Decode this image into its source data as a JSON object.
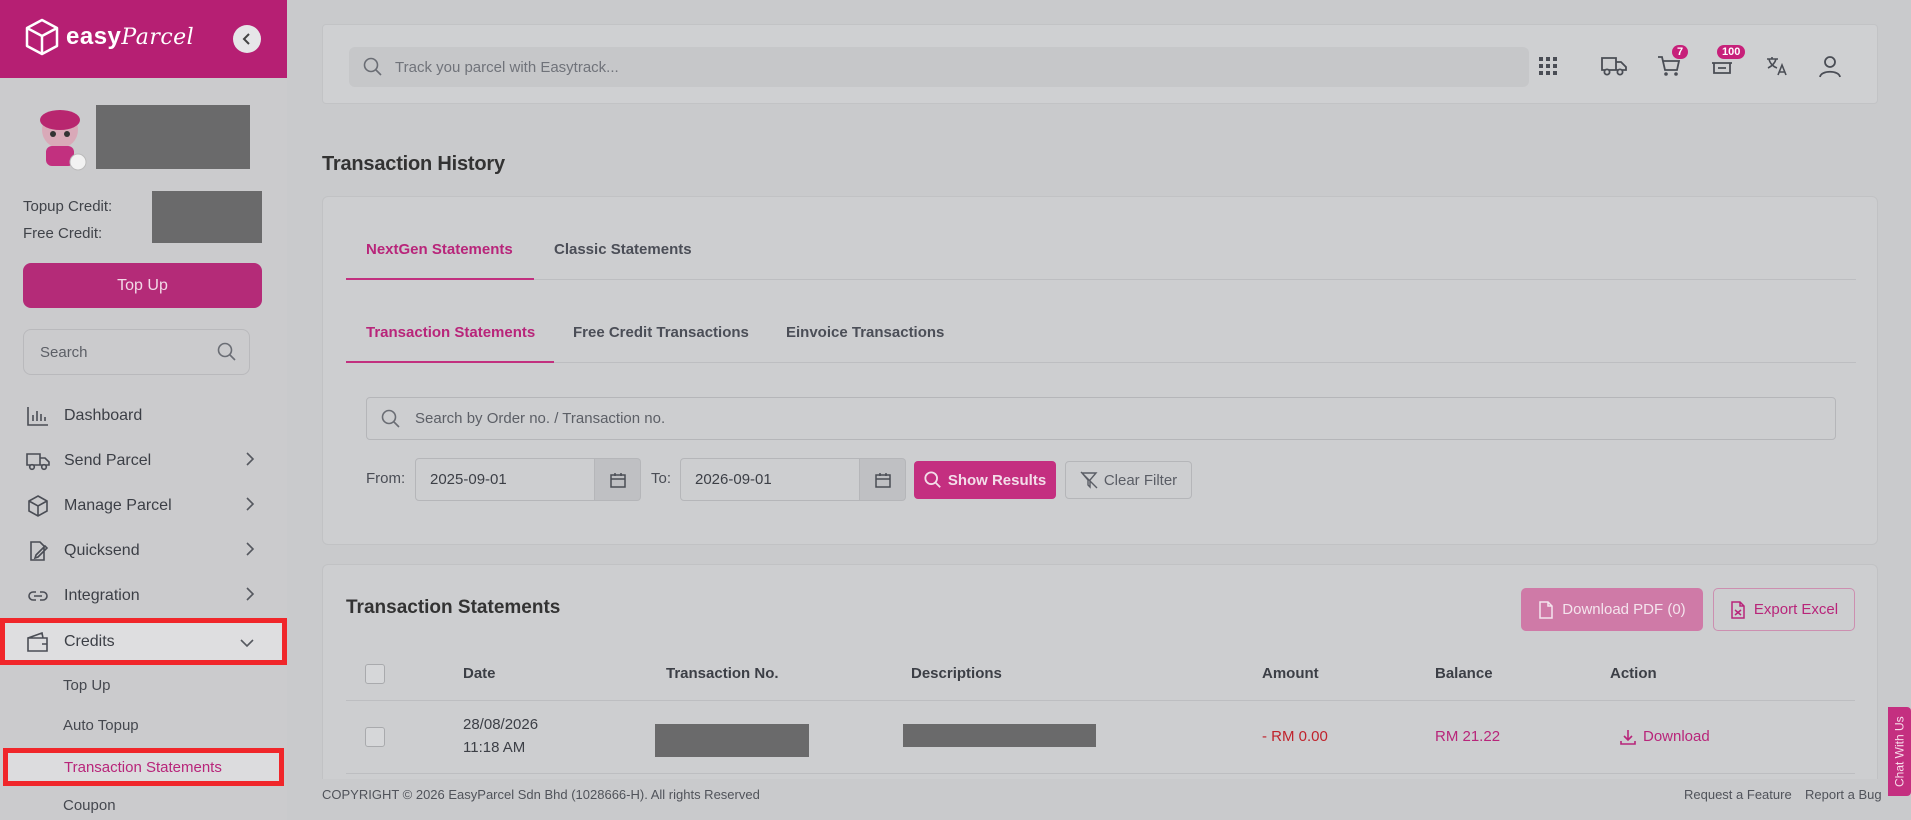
{
  "brand": {
    "logo_text": "easy",
    "logo_script": "Parcel"
  },
  "sidebar": {
    "topup_credit_label": "Topup Credit:",
    "free_credit_label": "Free Credit:",
    "topup_button": "Top Up",
    "search_placeholder": "Search",
    "items": [
      {
        "label": "Dashboard"
      },
      {
        "label": "Send Parcel"
      },
      {
        "label": "Manage Parcel"
      },
      {
        "label": "Quicksend"
      },
      {
        "label": "Integration"
      },
      {
        "label": "Credits"
      }
    ],
    "credits_sub": [
      "Top Up",
      "Auto Topup",
      "Transaction Statements",
      "Coupon"
    ]
  },
  "topbar": {
    "track_placeholder": "Track you parcel with Easytrack...",
    "cart_badge": "7",
    "notif_badge": "100"
  },
  "page": {
    "title": "Transaction History"
  },
  "tabs": {
    "primary": [
      "NextGen Statements",
      "Classic Statements"
    ],
    "secondary": [
      "Transaction Statements",
      "Free Credit Transactions",
      "Einvoice Transactions"
    ]
  },
  "filter": {
    "search_placeholder": "Search by Order no. / Transaction no.",
    "from_label": "From:",
    "from_value": "2025-09-01",
    "to_label": "To:",
    "to_value": "2026-09-01",
    "show_results": "Show Results",
    "clear_filter": "Clear Filter"
  },
  "statements": {
    "title": "Transaction Statements",
    "download_pdf": "Download PDF (0)",
    "export_excel": "Export Excel",
    "columns": [
      "Date",
      "Transaction No.",
      "Descriptions",
      "Amount",
      "Balance",
      "Action"
    ],
    "rows": [
      {
        "date": "28/08/2026",
        "time": "11:18 AM",
        "amount": "- RM 0.00",
        "balance": "RM 21.22",
        "action": "Download"
      }
    ]
  },
  "footer": {
    "copyright": "COPYRIGHT © 2026 EasyParcel Sdn Bhd (1028666-H). All rights Reserved",
    "request_feature": "Request a Feature",
    "report_bug": "Report a Bug",
    "chat": "Chat With Us"
  },
  "colors": {
    "brand": "#b61f73",
    "accent": "#c42f80",
    "highlight_box": "#f0262a"
  }
}
